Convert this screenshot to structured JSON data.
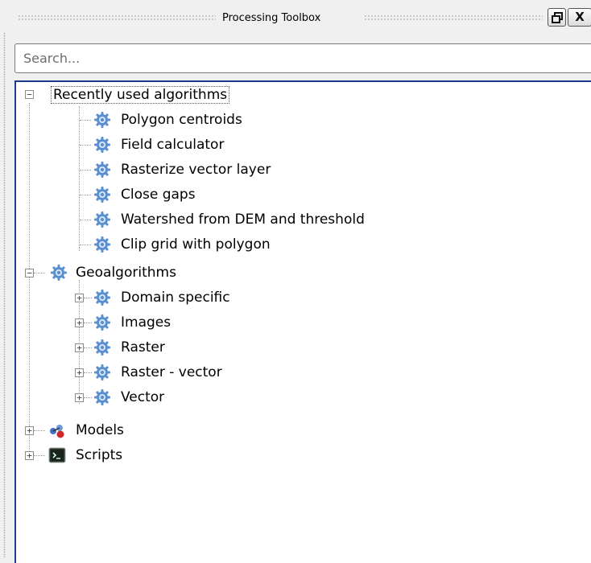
{
  "panel": {
    "title": "Processing Toolbox",
    "float_button": "🗗",
    "close_button": "X"
  },
  "search": {
    "placeholder": "Search..."
  },
  "tree": {
    "recent": {
      "label": "Recently used algorithms",
      "items": [
        "Polygon centroids",
        "Field calculator",
        "Rasterize vector layer",
        "Close gaps",
        "Watershed from DEM and threshold",
        "Clip grid with polygon"
      ]
    },
    "geo": {
      "label": "Geoalgorithms",
      "items": [
        "Domain specific",
        "Images",
        "Raster",
        "Raster - vector",
        "Vector"
      ]
    },
    "models": {
      "label": "Models"
    },
    "scripts": {
      "label": "Scripts"
    }
  },
  "colors": {
    "accent_border": "#1f3b8f",
    "gear": "#5b8fd0"
  },
  "icons": {
    "algorithm": "gear-icon",
    "models": "models-icon",
    "scripts": "terminal-icon"
  }
}
